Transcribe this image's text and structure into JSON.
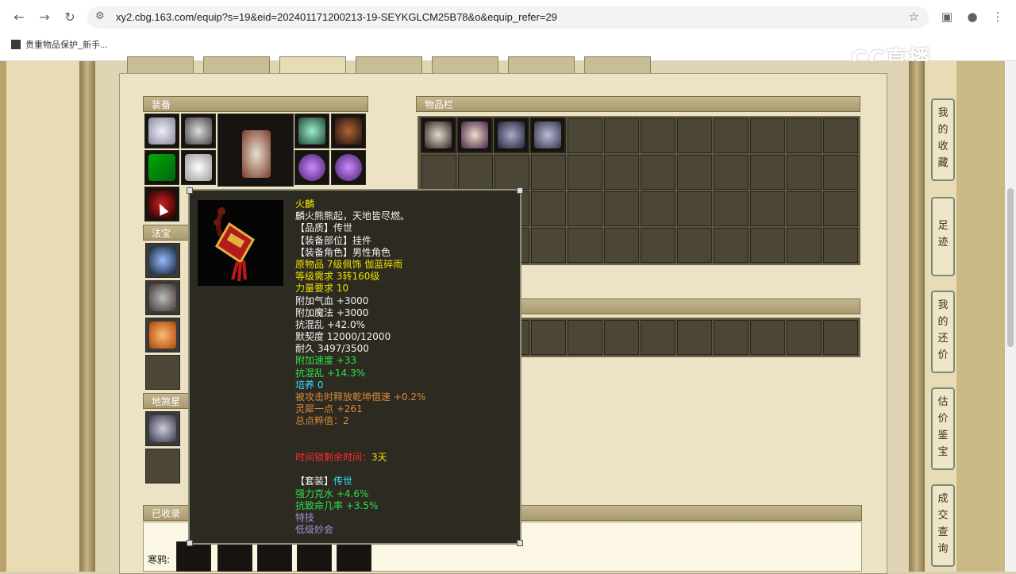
{
  "browser": {
    "url": "xy2.cbg.163.com/equip?s=19&eid=202401171200213-19-SEYKGLCM25B78&o&equip_refer=29",
    "bookmark": "贵重物品保护_新手..."
  },
  "logo": "CC直播",
  "sections": {
    "equip": "装备",
    "fabao": "法宝",
    "disha": "地煞星",
    "items": "物品栏",
    "received": "已收录",
    "hanya_label": "寒鸦:"
  },
  "side_nav": [
    {
      "label": "我的收藏"
    },
    {
      "label": "足迹"
    },
    {
      "label": "我的还价"
    },
    {
      "label": "估价鉴宝"
    },
    {
      "label": "成交查询"
    }
  ],
  "tooltip": {
    "name": "火麟",
    "desc": "麟火熊熊起，天地皆尽燃。",
    "quality": "【品质】传世",
    "slot": "【装备部位】挂件",
    "role": "【装备角色】男性角色",
    "origin": "原物品 7级佩饰 伽蓝碎雨",
    "level_req": "等级需求 3转160级",
    "str_req": "力量要求 10",
    "hp": "附加气血 +3000",
    "mp": "附加魔法 +3000",
    "anti_chaos": "抗混乱 +42.0%",
    "tacit": "默契度 12000/12000",
    "durability": "耐久 3497/3500",
    "speed": "附加速度 +33",
    "anti_chaos2": "抗混乱 +14.3%",
    "nurture": "培养 0",
    "passive": "被攻击时释放乾坤借速 +0.2%",
    "lingxi": "灵犀一点 +261",
    "total": "总点粹值：2",
    "time_label": "时间锁剩余时间：",
    "time_value": "3天",
    "set_label": "【套装】",
    "set_value": "传世",
    "set_attr1": "强力克水 +4.6%",
    "set_attr2": "抗致命几率 +3.5%",
    "skill_label": "特技",
    "skill_value": "低级妙会"
  },
  "colors": {
    "yellow": "#f0e000",
    "green": "#2ee24a",
    "cyan": "#33e0ff",
    "orange": "#d98a3a",
    "red": "#ff2a2a",
    "purple": "#a88bd6"
  }
}
